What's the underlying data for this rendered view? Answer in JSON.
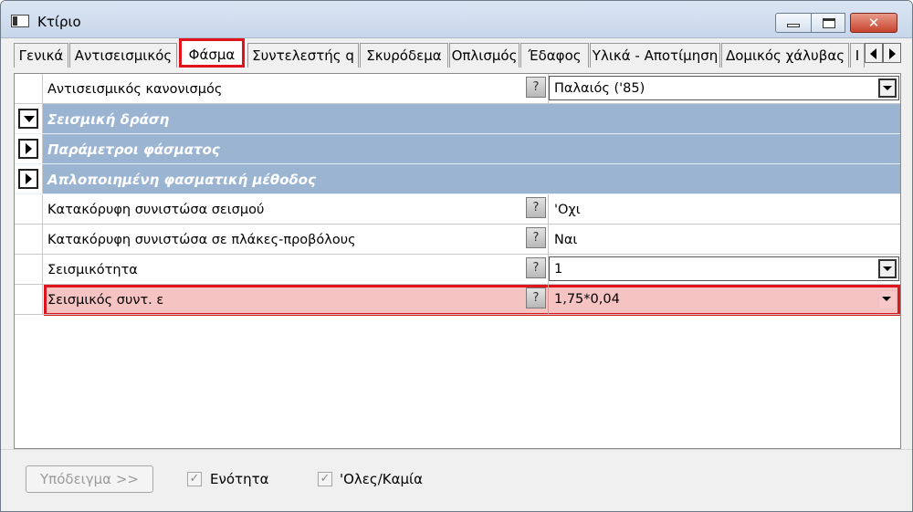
{
  "window": {
    "title": "Κτίριο",
    "controls": {
      "minimize": "minimize",
      "maximize": "maximize",
      "close": "✕"
    }
  },
  "tabs": [
    {
      "label": "Γενικά",
      "active": false
    },
    {
      "label": "Αντισεισμικός",
      "active": false
    },
    {
      "label": "Φάσμα",
      "active": true
    },
    {
      "label": "Συντελεστής q",
      "active": false
    },
    {
      "label": "Σκυρόδεμα",
      "active": false
    },
    {
      "label": "Οπλισμός",
      "active": false
    },
    {
      "label": "Έδαφος",
      "active": false
    },
    {
      "label": "Υλικά - Αποτίμηση",
      "active": false
    },
    {
      "label": "Δομικός χάλυβας",
      "active": false
    },
    {
      "label": "Ι",
      "active": false
    }
  ],
  "grid": {
    "help_symbol": "?",
    "rows": [
      {
        "kind": "prop",
        "label": "Αντισεισμικός κανονισμός",
        "value": "Παλαιός ('85)",
        "editor": "combo"
      },
      {
        "kind": "section",
        "label": "Σεισμική δράση",
        "expanded": true
      },
      {
        "kind": "section",
        "label": "Παράμετροι φάσματος",
        "expanded": false
      },
      {
        "kind": "section",
        "label": "Απλοποιημένη φασματική μέθοδος",
        "expanded": false
      },
      {
        "kind": "prop",
        "label": "Κατακόρυφη συνιστώσα σεισμού",
        "value": "'Οχι",
        "editor": "text"
      },
      {
        "kind": "prop",
        "label": "Κατακόρυφη συνιστώσα σε πλάκες-προβόλους",
        "value": "Ναι",
        "editor": "text"
      },
      {
        "kind": "prop",
        "label": "Σεισμικότητα",
        "value": "1",
        "editor": "combo"
      },
      {
        "kind": "prop",
        "label": "Σεισμικός συντ. ε",
        "value": "1,75*0,04",
        "editor": "combo-flat",
        "highlighted": true
      }
    ]
  },
  "footer": {
    "example_button": "Υπόδειγμα >>",
    "checkboxes": [
      {
        "label": "Ενότητα",
        "checked": true
      },
      {
        "label": "'Ολες/Καμία",
        "checked": true
      }
    ],
    "check_glyph": "✓"
  },
  "colors": {
    "section_bg": "#9ab4d2",
    "highlight_border": "#e0141c",
    "highlight_bg": "#f6c3c3"
  }
}
